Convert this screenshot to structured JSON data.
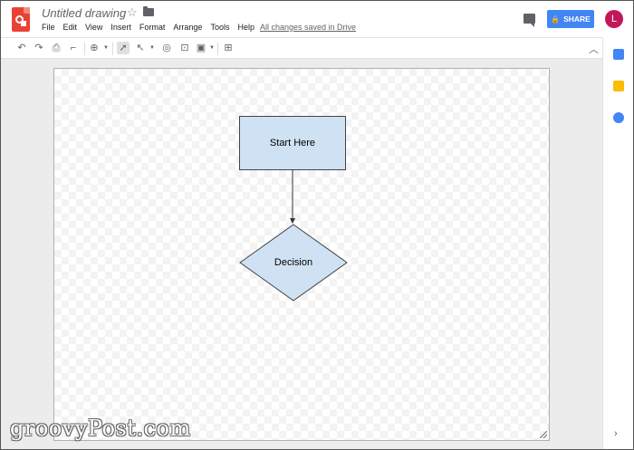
{
  "app": {
    "title": "Untitled drawing",
    "save_status": "All changes saved in Drive"
  },
  "menu": [
    "File",
    "Edit",
    "View",
    "Insert",
    "Format",
    "Arrange",
    "Tools",
    "Help"
  ],
  "share": {
    "label": "SHARE"
  },
  "user": {
    "avatar_letter": "L",
    "avatar_color": "#c2185b"
  },
  "accent": "#4285f4",
  "diagram": {
    "start_label": "Start Here",
    "decision_label": "Decision",
    "fill": "#cfe2f3"
  },
  "watermark": "groovyPost.com"
}
